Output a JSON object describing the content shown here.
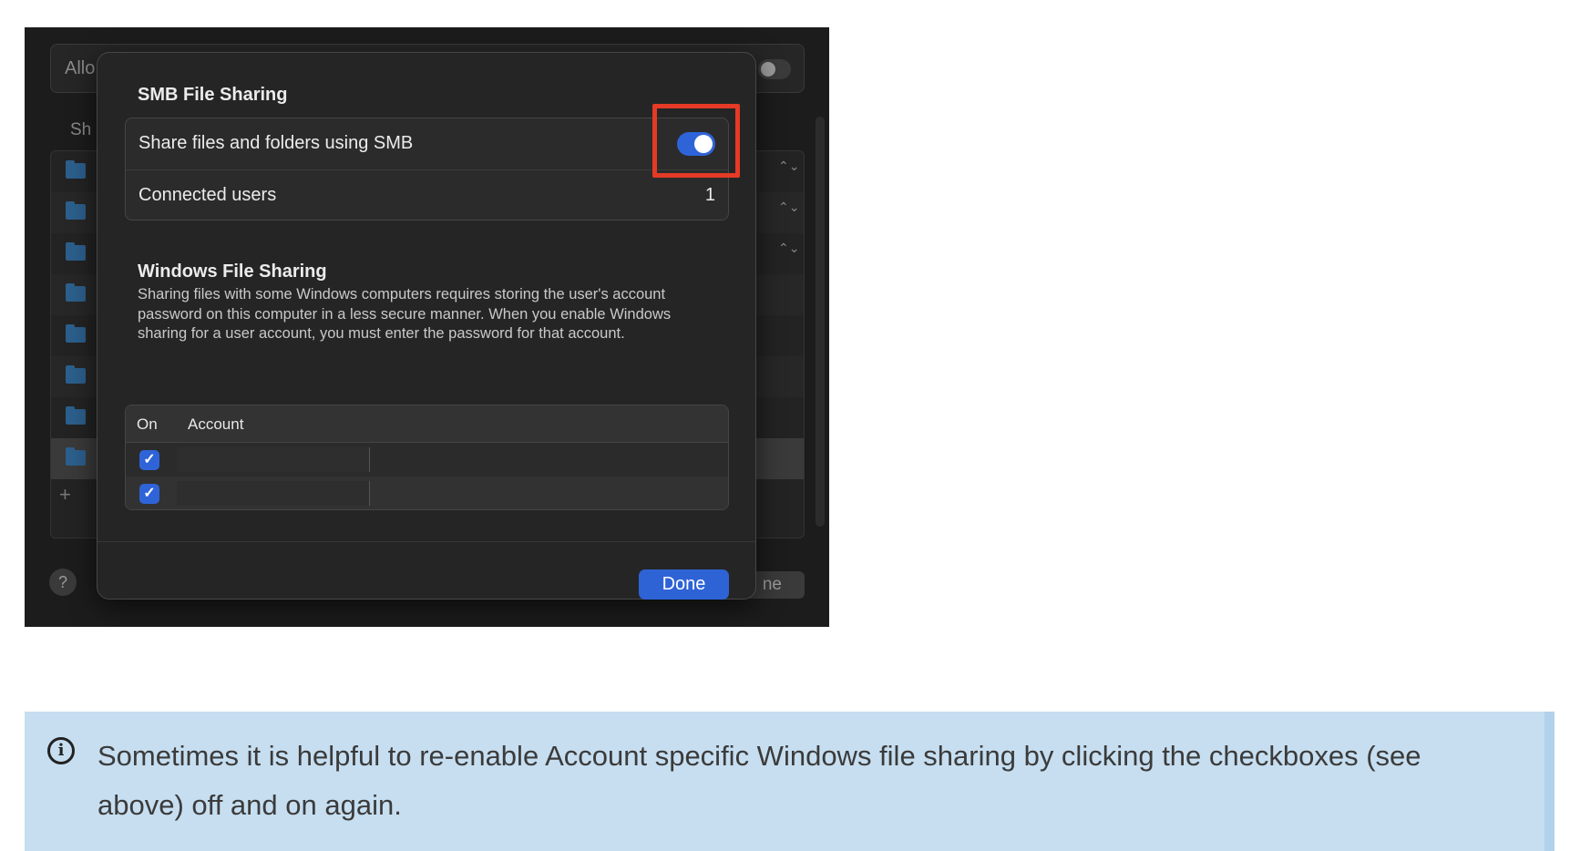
{
  "background_window": {
    "allow_label": "Allo",
    "shared_label": "Sh",
    "add_symbol": "+",
    "help_symbol": "?",
    "done_fragment": "ne",
    "stepper_symbol": "⌃⌄"
  },
  "sheet": {
    "smb_title": "SMB File Sharing",
    "share_toggle_label": "Share files and folders using SMB",
    "share_toggle_on": true,
    "connected_users_label": "Connected users",
    "connected_users_value": "1",
    "windows_title": "Windows File Sharing",
    "windows_description": "Sharing files with some Windows computers requires storing the user's account password on this computer in a less secure manner. When you enable Windows sharing for a user account, you must enter the password for that account.",
    "table": {
      "col_on": "On",
      "col_account": "Account",
      "check_glyph": "✓"
    },
    "done_label": "Done"
  },
  "callout": {
    "icon": "info-icon",
    "icon_glyph": "i",
    "text": "Sometimes it is helpful to re-enable Account specific Windows file sharing by clicking the checkboxes (see above) off and on again."
  },
  "colors": {
    "accent_blue": "#2f64d8",
    "highlight_red": "#e53a26",
    "callout_bg": "#c6def0"
  }
}
